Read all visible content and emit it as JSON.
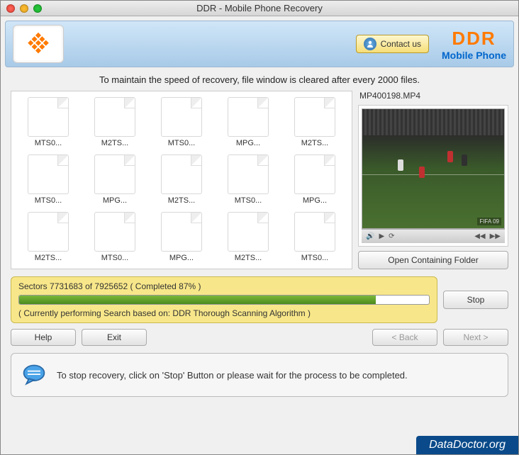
{
  "window": {
    "title": "DDR - Mobile Phone Recovery"
  },
  "banner": {
    "contact_label": "Contact us",
    "brand_main": "DDR",
    "brand_sub": "Mobile Phone"
  },
  "notice": "To maintain the speed of recovery, file window is cleared after every 2000 files.",
  "files": [
    {
      "label": "MTS0..."
    },
    {
      "label": "M2TS..."
    },
    {
      "label": "MTS0..."
    },
    {
      "label": "MPG..."
    },
    {
      "label": "M2TS..."
    },
    {
      "label": "MTS0..."
    },
    {
      "label": "MPG..."
    },
    {
      "label": "M2TS..."
    },
    {
      "label": "MTS0..."
    },
    {
      "label": "MPG..."
    },
    {
      "label": "M2TS..."
    },
    {
      "label": "MTS0..."
    },
    {
      "label": "MPG..."
    },
    {
      "label": "M2TS..."
    },
    {
      "label": "MTS0..."
    }
  ],
  "preview": {
    "filename": "MP400198.MP4",
    "watermark": "FIFA 09",
    "open_label": "Open Containing Folder"
  },
  "progress": {
    "sectors_line": "Sectors 7731683 of 7925652   ( Completed 87% )",
    "percent": 87,
    "algorithm_line": "( Currently performing Search based on: DDR Thorough Scanning Algorithm )",
    "stop_label": "Stop"
  },
  "nav": {
    "help": "Help",
    "exit": "Exit",
    "back": "< Back",
    "next": "Next >"
  },
  "tip": "To stop recovery, click on 'Stop' Button or please wait for the process to be completed.",
  "footer_brand": "DataDoctor.org"
}
